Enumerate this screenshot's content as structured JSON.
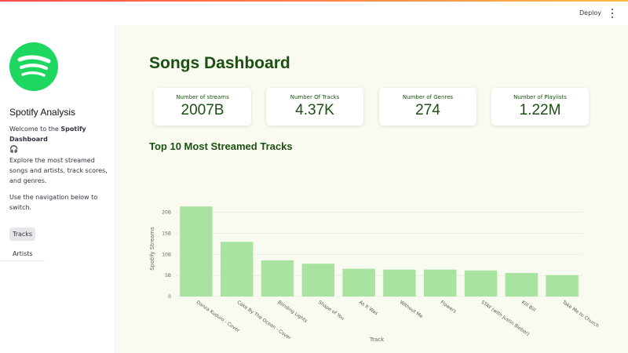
{
  "header": {
    "deploy_label": "Deploy"
  },
  "sidebar": {
    "app_title": "Spotify Analysis",
    "welcome_prefix": "Welcome to the ",
    "welcome_bold": "Spotify Dashboard",
    "headphones_glyph": "🎧",
    "description": "Explore the most streamed songs and artists, track scores, and genres.",
    "nav_hint": "Use the navigation below to switch.",
    "nav_items": [
      {
        "label": "Tracks",
        "active": true
      },
      {
        "label": "Artists",
        "active": false
      }
    ],
    "logo_color": "#1ed760"
  },
  "main": {
    "page_title": "Songs Dashboard",
    "metrics": [
      {
        "label": "Number of streams",
        "value": "2007B"
      },
      {
        "label": "Number Of Tracks",
        "value": "4.37K"
      },
      {
        "label": "Number of Genres",
        "value": "274"
      },
      {
        "label": "Number of Playlists",
        "value": "1.22M"
      }
    ],
    "chart_title": "Top 10 Most Streamed Tracks"
  },
  "colors": {
    "accent_dark_green": "#1c4f12",
    "bar_fill": "#a8e3a0",
    "main_bg": "#f9fbf1"
  },
  "chart_data": {
    "type": "bar",
    "title": "",
    "xlabel": "Track",
    "ylabel": "Spotify Streams",
    "categories": [
      "Danza Kuduro - Cover",
      "Cake By The Ocean - Cover",
      "Blinding Lights",
      "Shape of You",
      "As It Was",
      "Without Me",
      "Flowers",
      "STAY (with Justin Bieber)",
      "Kill Bill",
      "Take Me to Church"
    ],
    "values": [
      21.4,
      13.0,
      8.6,
      7.8,
      6.6,
      6.4,
      6.4,
      6.2,
      5.6,
      5.1
    ],
    "yticks": [
      "0",
      "5B",
      "10B",
      "15B",
      "20B"
    ],
    "ytick_values": [
      0,
      5,
      10,
      15,
      20
    ],
    "ylim": [
      0,
      22
    ],
    "grid": true
  }
}
